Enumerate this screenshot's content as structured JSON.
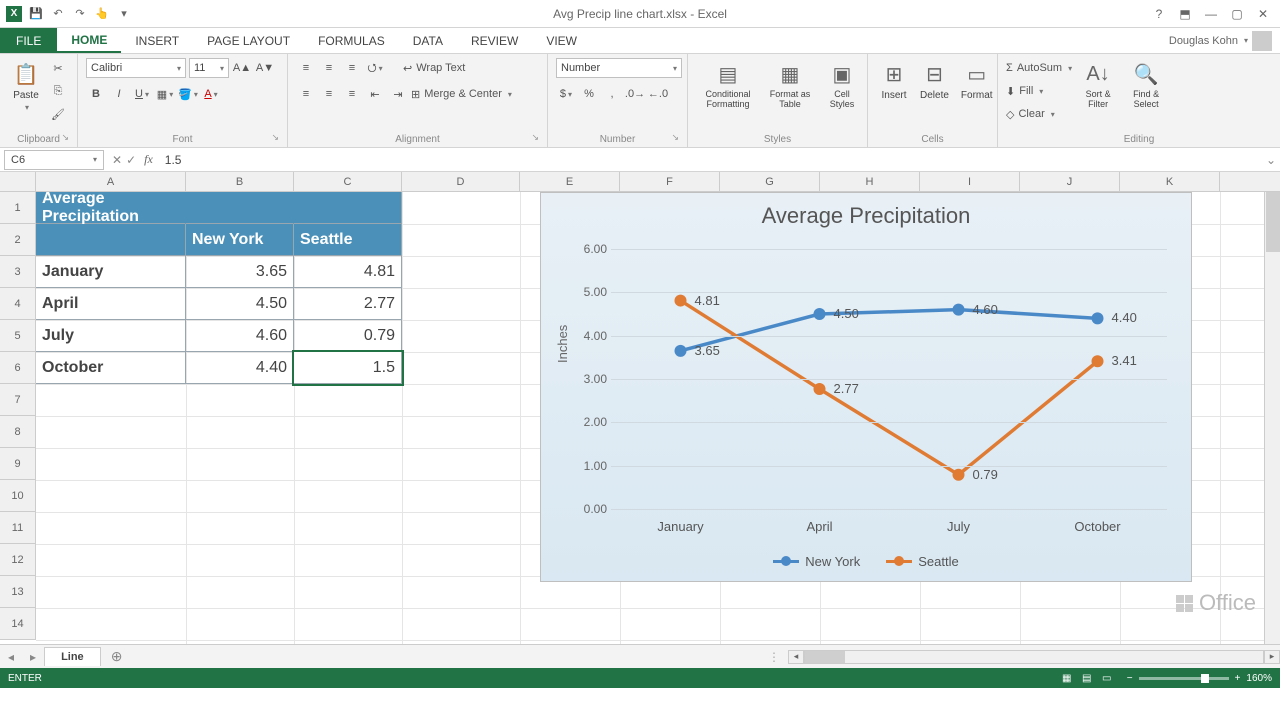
{
  "app": {
    "title": "Avg Precip line chart.xlsx - Excel",
    "user": "Douglas Kohn"
  },
  "qat": {
    "save": "💾",
    "undo": "↶",
    "redo": "↷",
    "touch": "👆"
  },
  "tabs": {
    "file": "FILE",
    "home": "HOME",
    "insert": "INSERT",
    "pagelayout": "PAGE LAYOUT",
    "formulas": "FORMULAS",
    "data": "DATA",
    "review": "REVIEW",
    "view": "VIEW"
  },
  "ribbon": {
    "clipboard": {
      "label": "Clipboard",
      "paste": "Paste"
    },
    "font": {
      "label": "Font",
      "name": "Calibri",
      "size": "11"
    },
    "alignment": {
      "label": "Alignment",
      "wrap": "Wrap Text",
      "merge": "Merge & Center"
    },
    "number": {
      "label": "Number",
      "format": "Number"
    },
    "styles": {
      "label": "Styles",
      "cond": "Conditional Formatting",
      "fmt_table": "Format as Table",
      "cell_styles": "Cell Styles"
    },
    "cells": {
      "label": "Cells",
      "insert": "Insert",
      "delete": "Delete",
      "format": "Format"
    },
    "editing": {
      "label": "Editing",
      "autosum": "AutoSum",
      "fill": "Fill",
      "clear": "Clear",
      "sort": "Sort & Filter",
      "find": "Find & Select"
    }
  },
  "fbar": {
    "name": "C6",
    "value": "1.5"
  },
  "columns": [
    "A",
    "B",
    "C",
    "D",
    "E",
    "F",
    "G",
    "H",
    "I",
    "J",
    "K"
  ],
  "rowcount": 14,
  "table": {
    "title": "Average Precipitation",
    "headers": [
      "",
      "New York",
      "Seattle"
    ],
    "rows": [
      {
        "label": "January",
        "ny": "3.65",
        "sea": "4.81"
      },
      {
        "label": "April",
        "ny": "4.50",
        "sea": "2.77"
      },
      {
        "label": "July",
        "ny": "4.60",
        "sea": "0.79"
      },
      {
        "label": "October",
        "ny": "4.40",
        "sea": "1.5"
      }
    ]
  },
  "chart_data": {
    "type": "line",
    "title": "Average Precipitation",
    "ylabel": "Inches",
    "xlabel": "",
    "categories": [
      "January",
      "April",
      "July",
      "October"
    ],
    "series": [
      {
        "name": "New York",
        "values": [
          3.65,
          4.5,
          4.6,
          4.4
        ],
        "color": "#4a89c8"
      },
      {
        "name": "Seattle",
        "values": [
          4.81,
          2.77,
          0.79,
          3.41
        ],
        "color": "#e07b33"
      }
    ],
    "ylim": [
      0.0,
      6.0
    ],
    "yticks": [
      "0.00",
      "1.00",
      "2.00",
      "3.00",
      "4.00",
      "5.00",
      "6.00"
    ],
    "data_labels": {
      "New York": [
        "3.65",
        "4.50",
        "4.60",
        "4.40"
      ],
      "Seattle": [
        "4.81",
        "2.77",
        "0.79",
        "3.41"
      ]
    }
  },
  "sheet_tabs": {
    "active": "Line"
  },
  "status": {
    "mode": "ENTER",
    "zoom": "160%"
  },
  "colors": {
    "accent": "#217346",
    "ny": "#4a89c8",
    "sea": "#e07b33",
    "table_header": "#4a90b8"
  }
}
